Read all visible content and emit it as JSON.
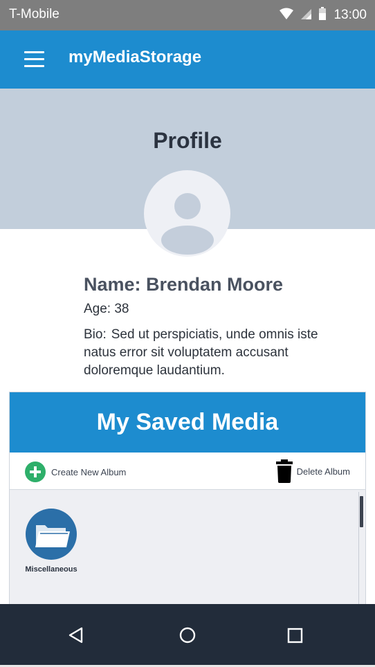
{
  "status_bar": {
    "carrier": "T-Mobile",
    "time": "13:00",
    "icons": [
      "wifi-icon",
      "cell-signal-icon",
      "battery-icon"
    ]
  },
  "app_bar": {
    "title": "myMediaStorage",
    "menu_icon": "hamburger-menu-icon"
  },
  "profile": {
    "title": "Profile",
    "avatar_icon": "user-avatar-icon",
    "name_line": "Name: Brendan Moore",
    "age_line": "Age: 38",
    "bio_label": "Bio:",
    "bio_text": "Sed ut perspiciatis, unde omnis iste natus error sit voluptatem accusant doloremque laudantium."
  },
  "saved_media": {
    "title": "My Saved Media",
    "create_label": "Create New Album",
    "delete_label": "Delete Album",
    "albums": [
      {
        "label": "Miscellaneous",
        "icon": "folder-icon"
      }
    ]
  },
  "nav_bar": {
    "buttons": [
      "back-icon",
      "home-icon",
      "recents-icon"
    ]
  },
  "colors": {
    "status_bar": "#7e7e7e",
    "primary": "#1d8ccf",
    "profile_bg": "#c2cedb",
    "add_green": "#2eaf6a",
    "folder_blue": "#2b6fa8",
    "nav_bar": "#222c3a"
  }
}
